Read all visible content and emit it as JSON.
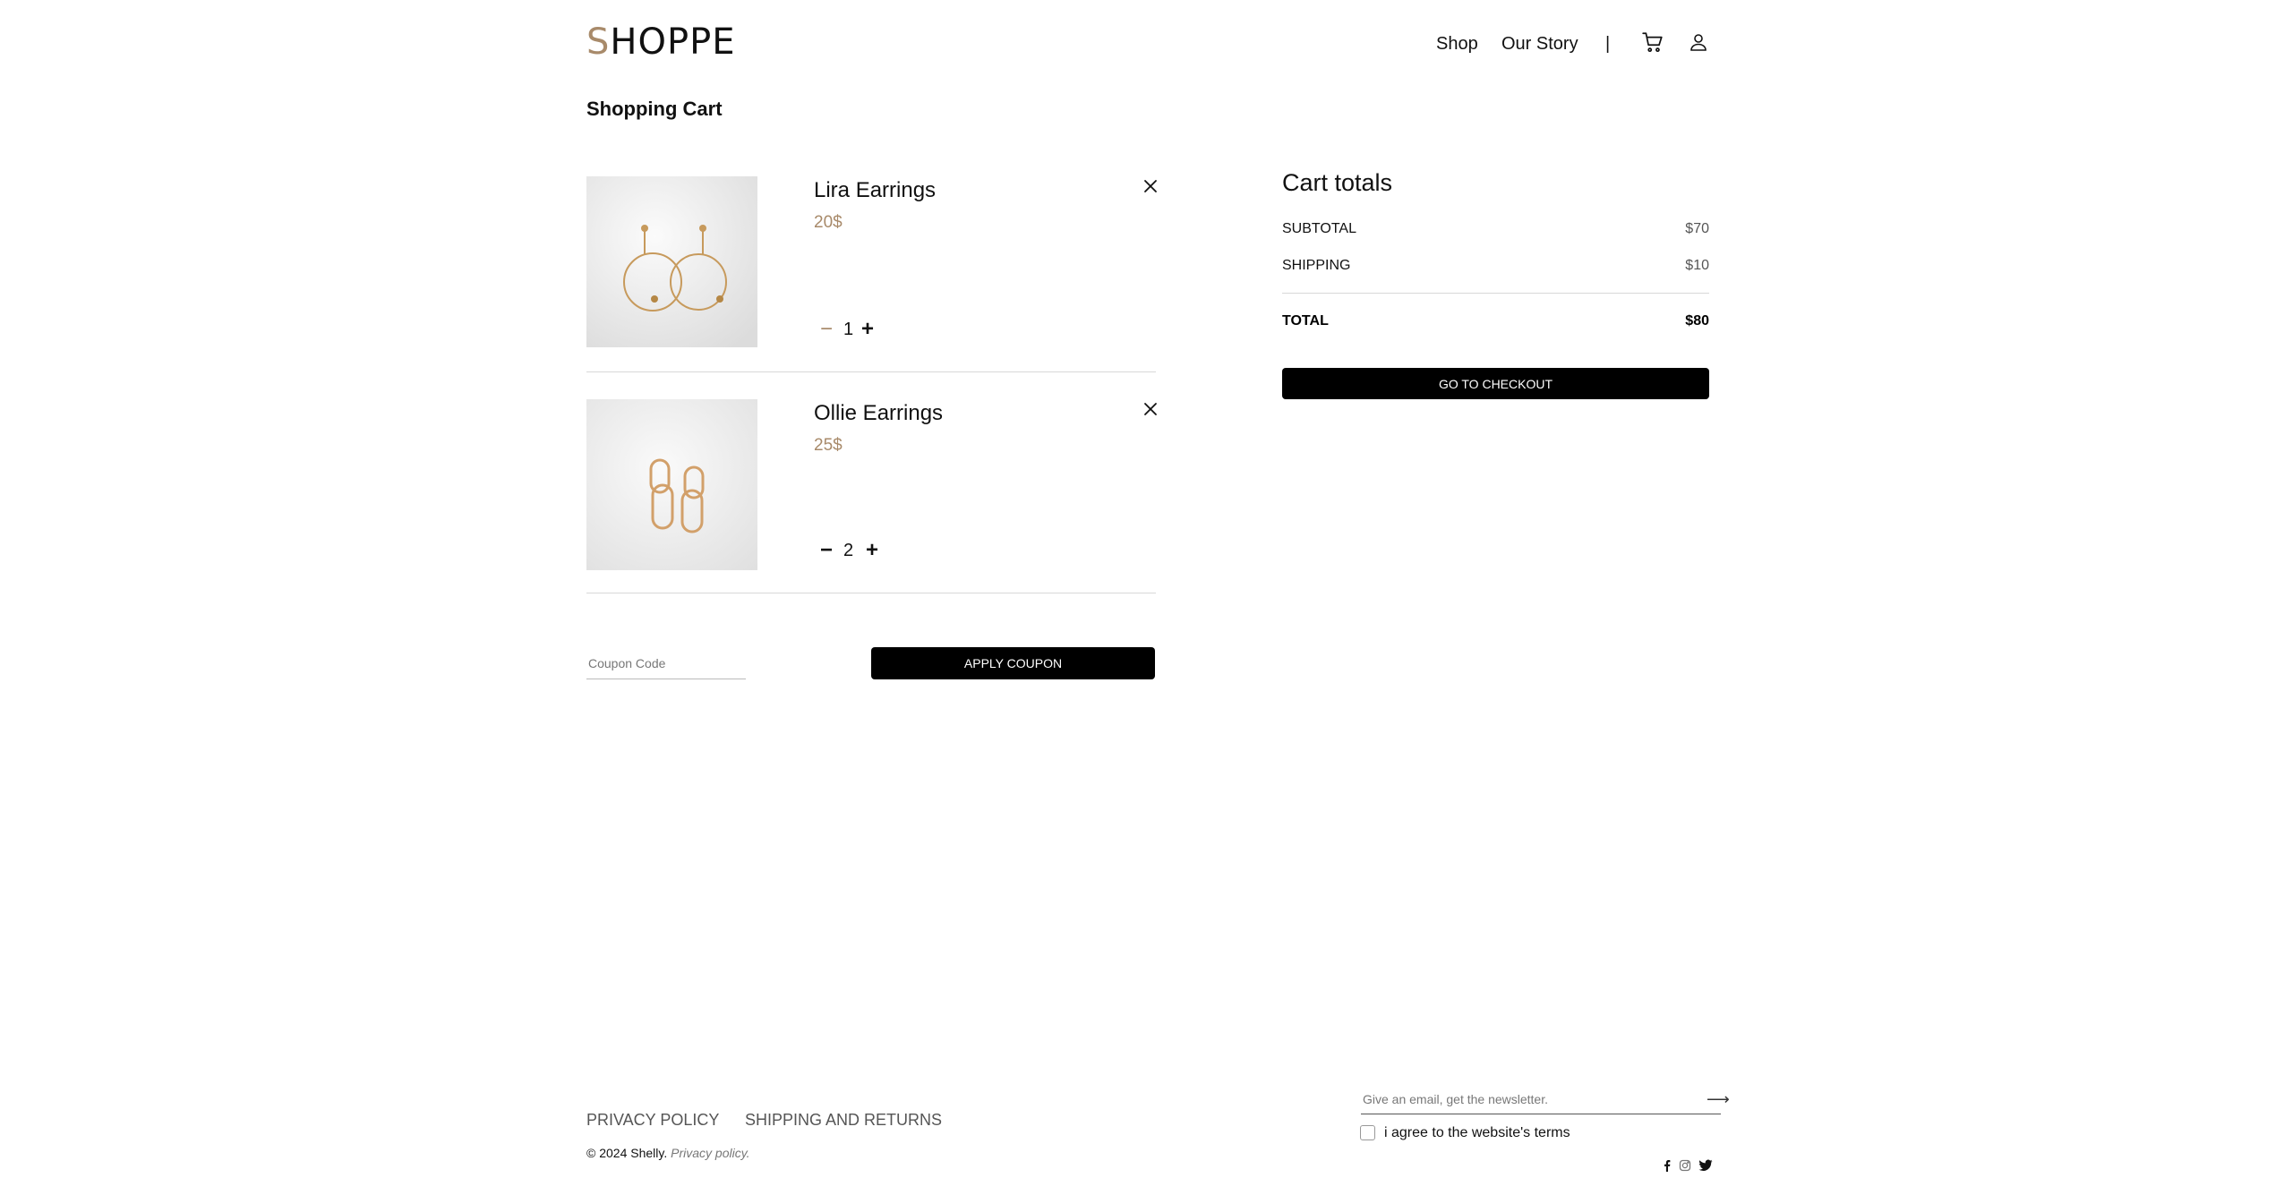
{
  "header": {
    "logo_first": "S",
    "logo_rest": "HOPPE",
    "nav": [
      {
        "label": "Shop"
      },
      {
        "label": "Our Story"
      }
    ],
    "separator": "|"
  },
  "page_title": "Shopping Cart",
  "cart": {
    "items": [
      {
        "name": "Lira Earrings",
        "price": "20$",
        "quantity": "1",
        "minus": "−",
        "plus": "+"
      },
      {
        "name": "Ollie Earrings",
        "price": "25$",
        "quantity": "2",
        "minus": "−",
        "plus": "+"
      }
    ]
  },
  "coupon": {
    "placeholder": "Coupon Code",
    "value": "",
    "apply_label": "APPLY COUPON"
  },
  "totals": {
    "title": "Cart totals",
    "subtotal_label": "SUBTOTAL",
    "subtotal_value": "$70",
    "shipping_label": "SHIPPING",
    "shipping_value": "$10",
    "total_label": "TOTAL",
    "total_value": "$80",
    "checkout_label": "GO TO CHECKOUT"
  },
  "footer": {
    "links": [
      {
        "label": "PRIVACY POLICY"
      },
      {
        "label": "SHIPPING AND RETURNS"
      }
    ],
    "copyright_text": "© 2024 Shelly.",
    "copyright_link": "Privacy policy.",
    "newsletter_placeholder": "Give an email, get the newsletter.",
    "newsletter_arrow": "⟶",
    "agree_label": "i agree to the website's terms",
    "socials": [
      "facebook-icon",
      "instagram-icon",
      "twitter-icon"
    ]
  },
  "colors": {
    "accent": "#a88a6a",
    "button_bg": "#000000",
    "divider": "#d8d8d8"
  }
}
